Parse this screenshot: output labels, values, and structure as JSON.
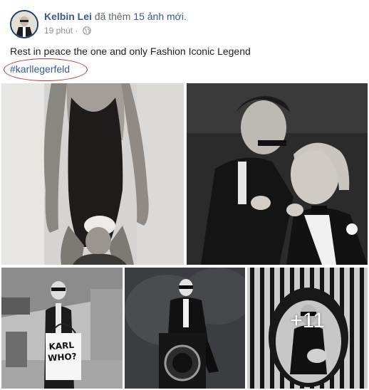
{
  "post": {
    "author": "Kelbin Lei",
    "action_prefix": "đã thêm",
    "action_count": "15 ảnh mới",
    "action_suffix": ".",
    "timestamp": "19 phút",
    "separator": "·",
    "privacy_icon": "globe-icon",
    "text": "Rest in peace the one and only Fashion Iconic Legend",
    "hashtag": "#karllegerfeld",
    "annotation_color": "#d0312d",
    "link_color": "#385898"
  },
  "photos": {
    "items": [
      {
        "name": "photo-swimsuit"
      },
      {
        "name": "photo-two-men"
      },
      {
        "name": "photo-airport"
      },
      {
        "name": "photo-washing-machine"
      },
      {
        "name": "photo-egg-chair"
      }
    ],
    "more_count": "+11",
    "sign_text_line1": "KARL",
    "sign_text_line2": "WHO?"
  }
}
